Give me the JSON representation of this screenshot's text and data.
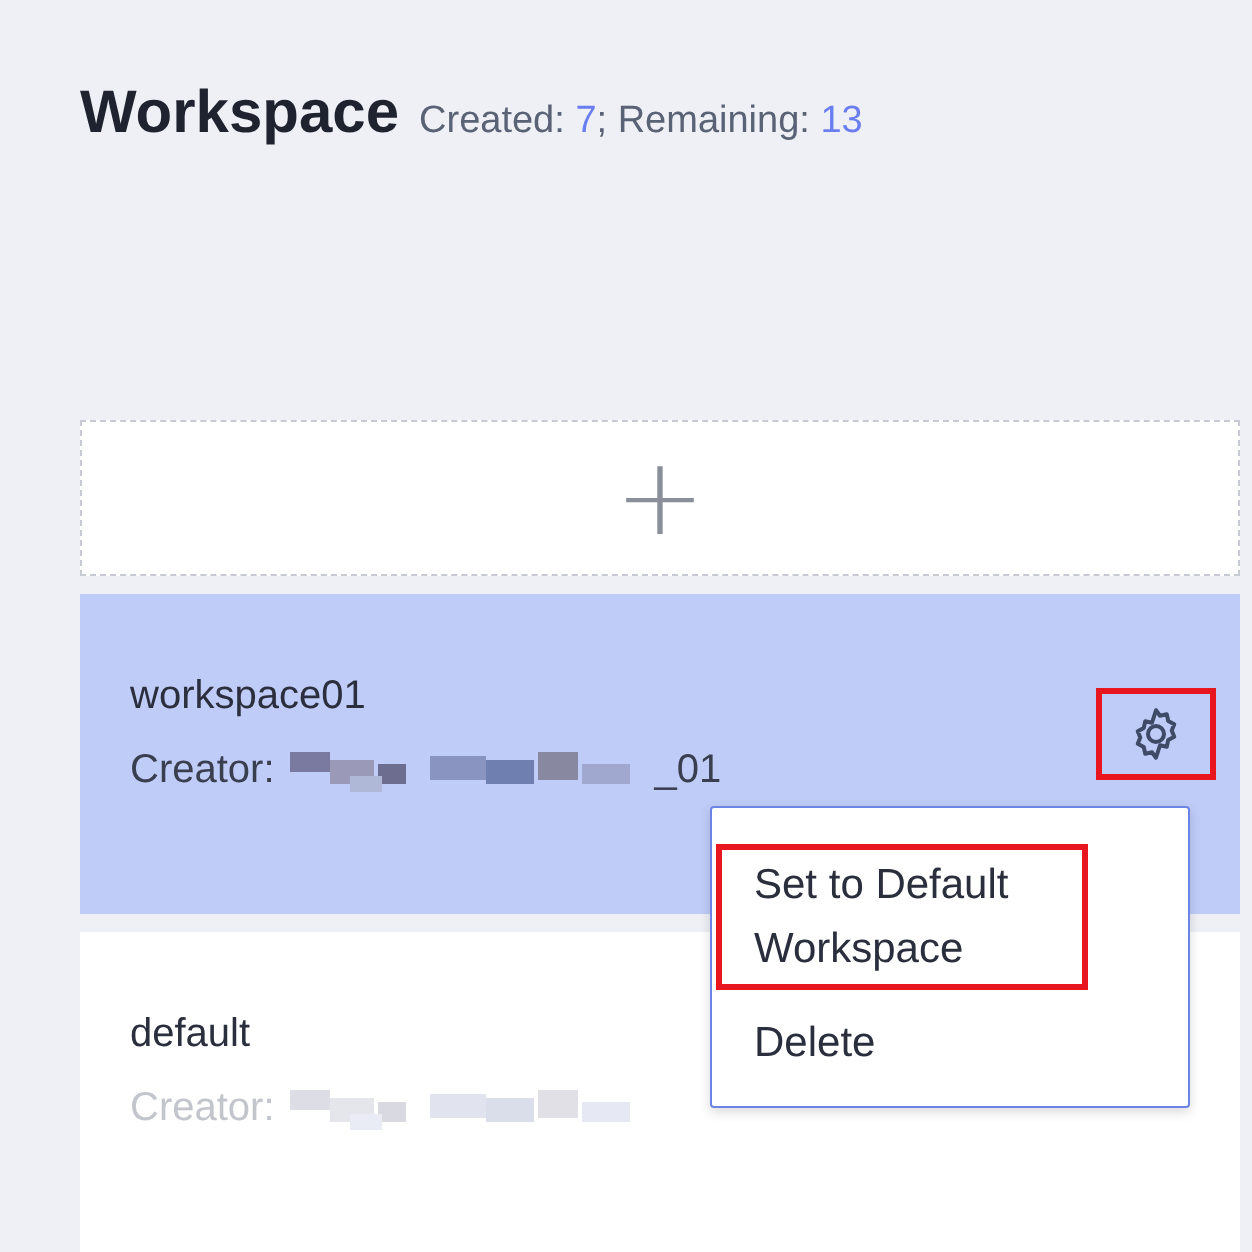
{
  "header": {
    "title": "Workspace",
    "created_label": "Created: ",
    "created": "7",
    "separator": "; Remaining: ",
    "remaining": "13"
  },
  "add_card": {
    "icon": "+"
  },
  "workspaces": [
    {
      "name": "workspace01",
      "creator_label": "Creator:",
      "creator_tail": "_01",
      "selected": true,
      "settings": {
        "highlighted": true
      },
      "dimmed": false
    },
    {
      "name": "default",
      "creator_label": "Creator:",
      "selected": false,
      "dimmed": true
    }
  ],
  "menu": {
    "items": [
      {
        "label": "Set to Default Workspace",
        "highlighted": true
      },
      {
        "label": "Delete",
        "highlighted": false
      }
    ]
  }
}
